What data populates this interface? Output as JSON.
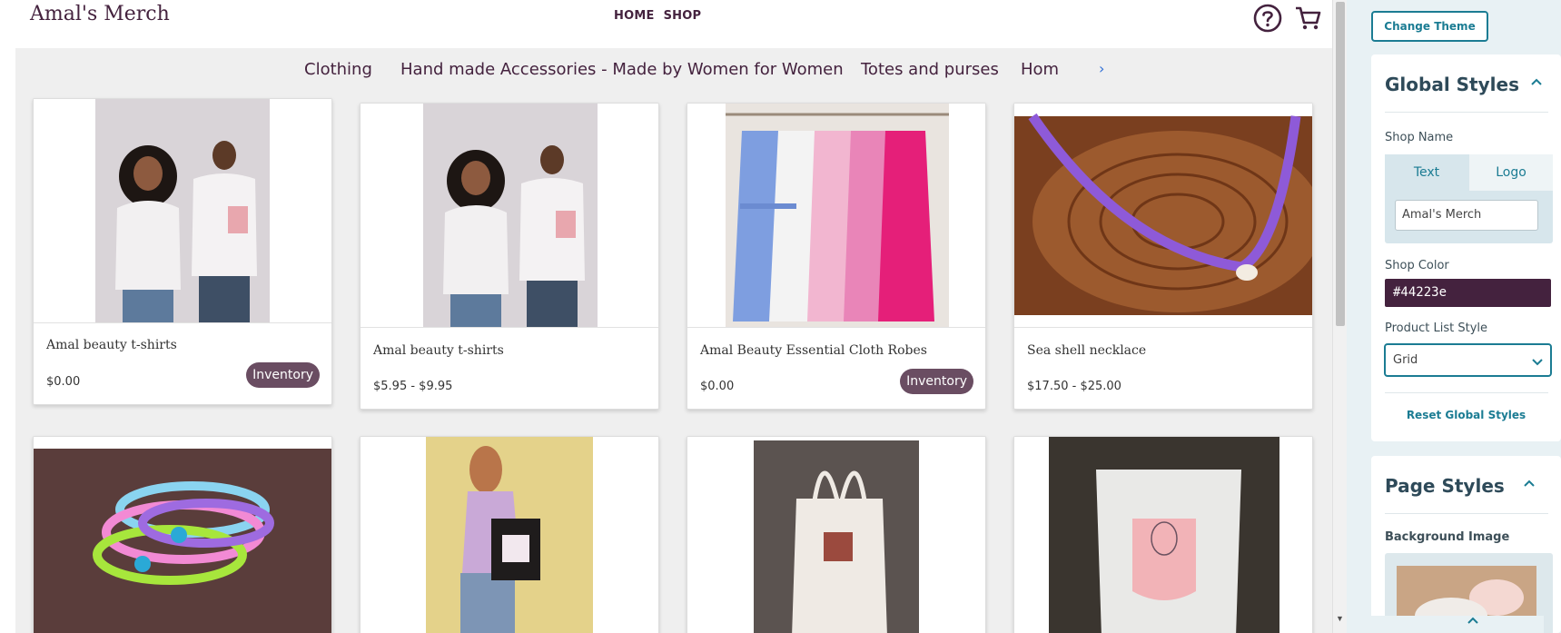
{
  "store": {
    "shop_name": "Amal's Merch",
    "nav": [
      "HOME",
      "SHOP"
    ],
    "icons": [
      "help-circle-icon",
      "shopping-cart-icon"
    ],
    "categories": [
      "Clothing",
      "Hand made Accessories - Made by Women for Women",
      "Totes and purses",
      "Home"
    ],
    "category_next_icon": "chevron-right-icon",
    "products": [
      {
        "title": "Amal beauty t-shirts",
        "price": "$0.00",
        "badge": "Inventory"
      },
      {
        "title": "Amal beauty t-shirts",
        "price": "$5.95 - $9.95",
        "badge": ""
      },
      {
        "title": "Amal Beauty Essential Cloth Robes",
        "price": "$0.00",
        "badge": "Inventory"
      },
      {
        "title": "Sea shell necklace",
        "price": "$17.50 - $25.00",
        "badge": ""
      }
    ],
    "second_row_images": [
      "bracelets-photo",
      "tote-bag-model-photo",
      "canvas-tote-photo",
      "mug-photo"
    ]
  },
  "panel": {
    "change_theme": "Change Theme",
    "global_styles": {
      "title": "Global Styles",
      "shop_name_label": "Shop Name",
      "text_tab": "Text",
      "logo_tab": "Logo",
      "shop_name_value": "Amal's Merch",
      "shop_color_label": "Shop Color",
      "shop_color_value": "#44223e",
      "product_list_style_label": "Product List Style",
      "product_list_style_value": "Grid",
      "reset": "Reset Global Styles"
    },
    "page_styles": {
      "title": "Page Styles",
      "background_image_label": "Background Image"
    }
  },
  "colors": {
    "brand": "#44223e",
    "accent": "#1b7c93",
    "badge": "#6a4d62"
  }
}
